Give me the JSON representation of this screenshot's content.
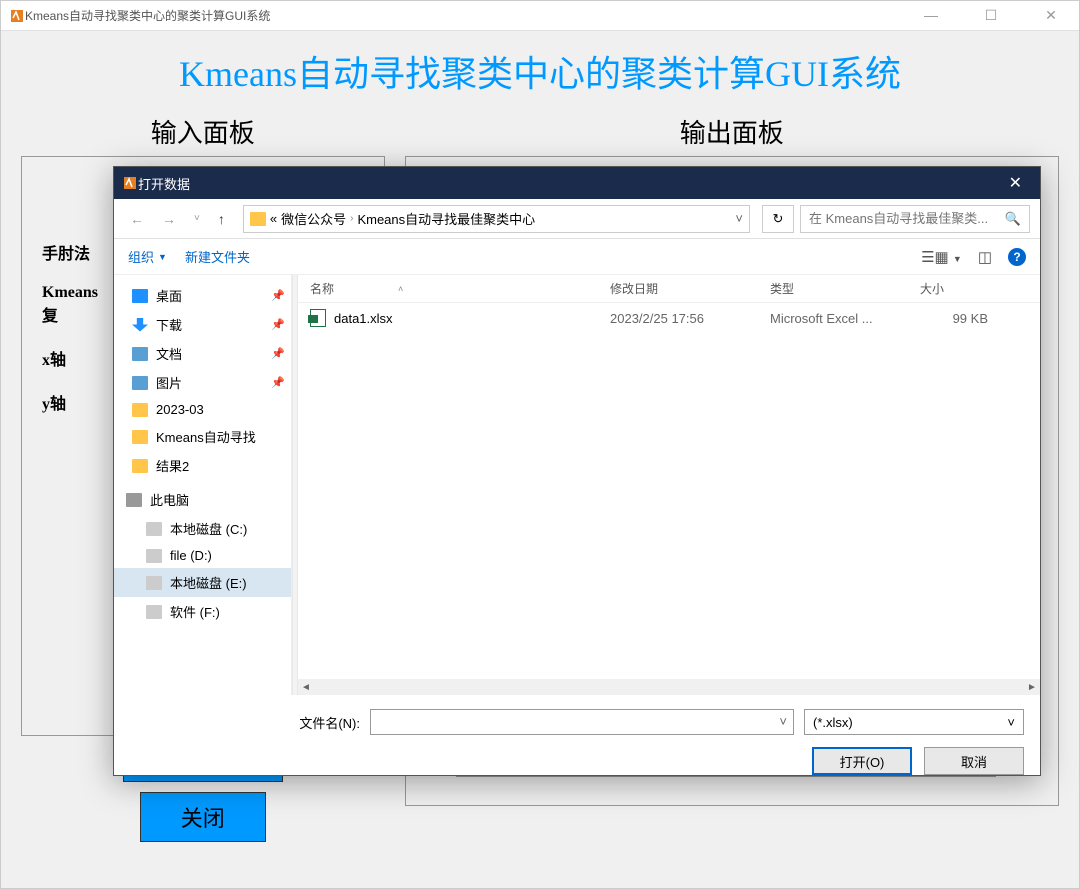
{
  "main_window": {
    "title": "Kmeans自动寻找聚类中心的聚类计算GUI系统",
    "app_title": "Kmeans自动寻找聚类中心的聚类计算GUI系统",
    "input_panel_title": "输入面板",
    "output_panel_title": "输出面板",
    "labels": {
      "elbow": "手肘法",
      "kmeans_repeat": "Kmeans\n复",
      "x_axis": "x轴",
      "y_axis": "y轴"
    },
    "close_label": "关闭"
  },
  "dialog": {
    "title": "打开数据",
    "breadcrumb": {
      "sep": "«",
      "parts": [
        "微信公众号",
        "Kmeans自动寻找最佳聚类中心"
      ]
    },
    "search_placeholder": "在 Kmeans自动寻找最佳聚类...",
    "toolbar": {
      "organize": "组织",
      "new_folder": "新建文件夹"
    },
    "tree": [
      {
        "icon": "desktop",
        "label": "桌面",
        "pin": true
      },
      {
        "icon": "download",
        "label": "下载",
        "pin": true
      },
      {
        "icon": "doc",
        "label": "文档",
        "pin": true
      },
      {
        "icon": "pic",
        "label": "图片",
        "pin": true
      },
      {
        "icon": "folder",
        "label": "2023-03"
      },
      {
        "icon": "folder",
        "label": "Kmeans自动寻找"
      },
      {
        "icon": "folder",
        "label": "结果2"
      },
      {
        "icon": "pc",
        "label": "此电脑",
        "group": true
      },
      {
        "icon": "drive",
        "label": "本地磁盘 (C:)",
        "indent": true
      },
      {
        "icon": "drive",
        "label": "file (D:)",
        "indent": true
      },
      {
        "icon": "drive",
        "label": "本地磁盘 (E:)",
        "indent": true,
        "selected": true
      },
      {
        "icon": "drive",
        "label": "软件 (F:)",
        "indent": true
      }
    ],
    "columns": {
      "name": "名称",
      "date": "修改日期",
      "type": "类型",
      "size": "大小"
    },
    "files": [
      {
        "name": "data1.xlsx",
        "date": "2023/2/25 17:56",
        "type": "Microsoft Excel ...",
        "size": "99 KB"
      }
    ],
    "filename_label": "文件名(N):",
    "filename_value": "",
    "filetype_value": "(*.xlsx)",
    "open_btn": "打开(O)",
    "cancel_btn": "取消"
  }
}
